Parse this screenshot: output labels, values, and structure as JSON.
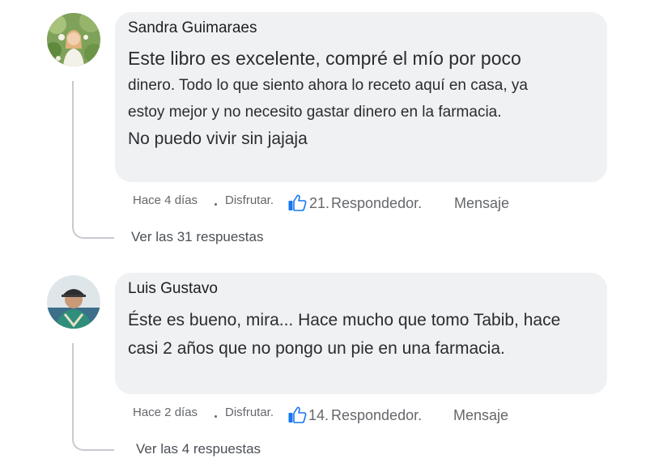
{
  "comments": [
    {
      "author": "Sandra Guimaraes",
      "lines": [
        "Este libro es excelente, compré el mío por poco",
        "dinero. Todo lo que siento ahora lo receto aquí en casa, ya",
        "estoy mejor y no necesito gastar dinero en la farmacia.",
        "No puedo vivir sin jajaja"
      ],
      "time": "Hace 4 días",
      "enjoy": "Disfrutar.",
      "likes": "21.",
      "reply": "Respondedor.",
      "message": "Mensaje",
      "view_replies": "Ver las 31 respuestas"
    },
    {
      "author": "Luis Gustavo",
      "lines": [
        "Éste es bueno, mira... Hace mucho que tomo Tabib, hace",
        "casi 2 años que no pongo un pie en una farmacia."
      ],
      "time": "Hace 2 días",
      "enjoy": "Disfrutar.",
      "likes": "14.",
      "reply": "Respondedor.",
      "message": "Mensaje",
      "view_replies": "Ver las 4 respuestas"
    }
  ],
  "colors": {
    "bubble": "#f0f1f3",
    "meta_text": "#65676b",
    "like_blue": "#1877f2",
    "thread_line": "#c7cacf"
  }
}
